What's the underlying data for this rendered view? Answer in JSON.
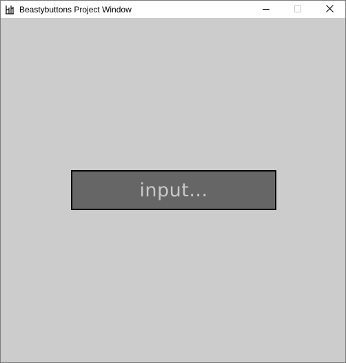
{
  "window": {
    "title": "Beastybuttons Project Window",
    "icon": "processing-app-icon",
    "controls": {
      "minimize": "minimize-icon",
      "maximize": "maximize-icon",
      "close": "close-icon"
    }
  },
  "canvas": {
    "background": "#cccccc",
    "input": {
      "placeholder": "input...",
      "fill": "#666666",
      "border": "#000000",
      "text_color": "#c8c8c8"
    }
  }
}
